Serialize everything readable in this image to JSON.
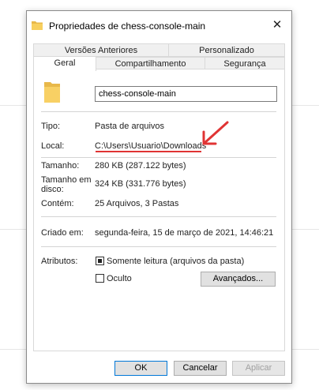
{
  "window": {
    "title": "Propriedades de chess-console-main",
    "close_icon": "close-icon"
  },
  "tabs": {
    "row1": [
      "Versões Anteriores",
      "Personalizado"
    ],
    "row2": [
      "Geral",
      "Compartilhamento",
      "Segurança"
    ],
    "active": "Geral"
  },
  "general": {
    "name": "chess-console-main",
    "type_label": "Tipo:",
    "type_value": "Pasta de arquivos",
    "location_label": "Local:",
    "location_value": "C:\\Users\\Usuario\\Downloads",
    "size_label": "Tamanho:",
    "size_value": "280 KB (287.122 bytes)",
    "disk_size_label_1": "Tamanho em",
    "disk_size_label_2": "disco:",
    "disk_size_value": "324 KB (331.776 bytes)",
    "contains_label": "Contém:",
    "contains_value": "25 Arquivos, 3 Pastas",
    "created_label": "Criado em:",
    "created_value": "segunda-feira, 15 de março de 2021, 14:46:21",
    "attributes_label": "Atributos:",
    "readonly_label": "Somente leitura (arquivos da pasta)",
    "readonly_checked": true,
    "hidden_label": "Oculto",
    "hidden_checked": false,
    "advanced_button": "Avançados..."
  },
  "footer": {
    "ok": "OK",
    "cancel": "Cancelar",
    "apply": "Aplicar"
  },
  "annotation": {
    "color": "#e03434"
  }
}
